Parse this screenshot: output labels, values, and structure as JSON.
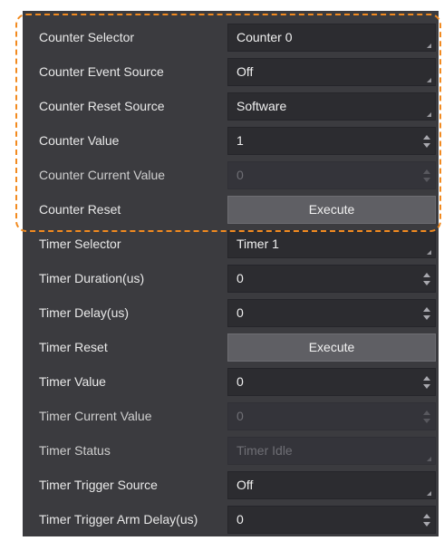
{
  "highlight_color": "#f28a1f",
  "rows": [
    {
      "label": "Counter Selector",
      "type": "dropdown",
      "value": "Counter 0",
      "icon": "dropdown-corner-icon"
    },
    {
      "label": "Counter Event Source",
      "type": "dropdown",
      "value": "Off",
      "icon": "dropdown-corner-icon"
    },
    {
      "label": "Counter Reset Source",
      "type": "dropdown",
      "value": "Software",
      "icon": "dropdown-corner-icon"
    },
    {
      "label": "Counter Value",
      "type": "spinner",
      "value": "1",
      "icon": "spinner-arrows-icon"
    },
    {
      "label": "Counter Current Value",
      "type": "spinner-disabled",
      "value": "0",
      "icon": "spinner-arrows-icon"
    },
    {
      "label": "Counter Reset",
      "type": "button",
      "value": "Execute"
    },
    {
      "label": "Timer Selector",
      "type": "dropdown",
      "value": "Timer 1",
      "icon": "dropdown-corner-icon"
    },
    {
      "label": "Timer Duration(us)",
      "type": "spinner",
      "value": "0",
      "icon": "spinner-arrows-icon"
    },
    {
      "label": "Timer Delay(us)",
      "type": "spinner",
      "value": "0",
      "icon": "spinner-arrows-icon"
    },
    {
      "label": "Timer Reset",
      "type": "button",
      "value": "Execute"
    },
    {
      "label": "Timer Value",
      "type": "spinner",
      "value": "0",
      "icon": "spinner-arrows-icon"
    },
    {
      "label": "Timer Current Value",
      "type": "spinner-disabled",
      "value": "0",
      "icon": "spinner-arrows-icon"
    },
    {
      "label": "Timer Status",
      "type": "dropdown-disabled",
      "value": "Timer Idle",
      "icon": "dropdown-corner-icon"
    },
    {
      "label": "Timer Trigger Source",
      "type": "dropdown",
      "value": "Off",
      "icon": "dropdown-corner-icon"
    },
    {
      "label": "Timer Trigger Arm Delay(us)",
      "type": "spinner",
      "value": "0",
      "icon": "spinner-arrows-icon"
    }
  ]
}
